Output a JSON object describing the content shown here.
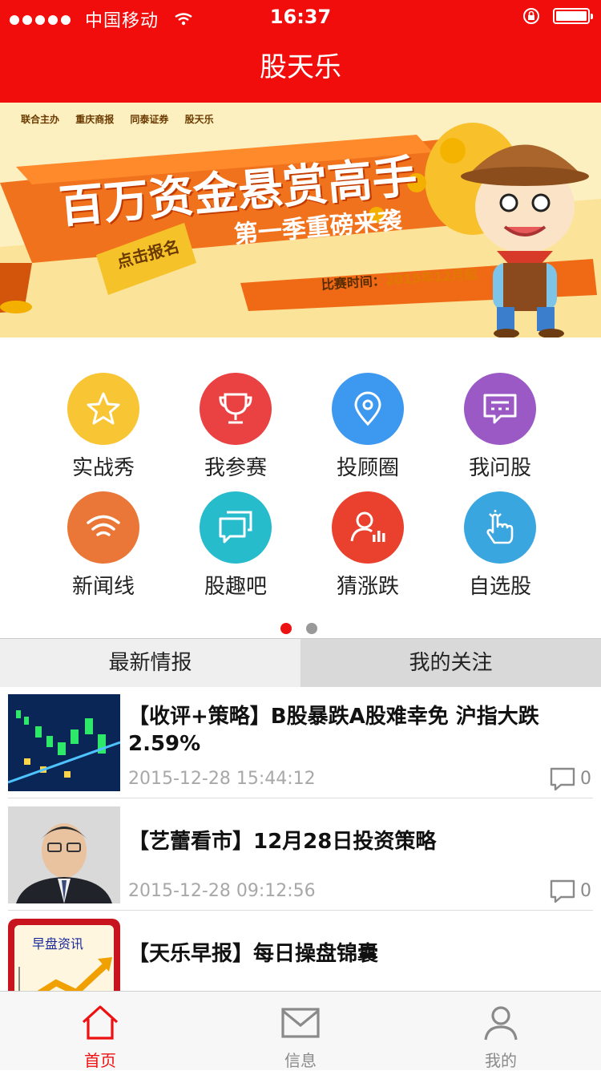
{
  "status_bar": {
    "carrier": "中国移动",
    "time": "16:37"
  },
  "header": {
    "title": "股天乐"
  },
  "banner": {
    "sponsors": [
      "联合主办",
      "重庆商报",
      "同泰证券",
      "股天乐"
    ],
    "main_title": "百万资金悬赏高手",
    "sub_title": "第一季重磅来袭",
    "cta": "点击报名",
    "date_label": "比赛时间：",
    "date_value": "2015年12月起"
  },
  "grid": {
    "items": [
      {
        "label": "实战秀",
        "icon": "star-icon",
        "color": "#f8c534"
      },
      {
        "label": "我参赛",
        "icon": "trophy-icon",
        "color": "#ea4242"
      },
      {
        "label": "投顾圈",
        "icon": "location-pin-icon",
        "color": "#3d98f0"
      },
      {
        "label": "我问股",
        "icon": "chat-icon",
        "color": "#9b59c6"
      },
      {
        "label": "新闻线",
        "icon": "wifi-icon",
        "color": "#ea7637"
      },
      {
        "label": "股趣吧",
        "icon": "chat-bubbles-icon",
        "color": "#27bccc"
      },
      {
        "label": "猜涨跌",
        "icon": "user-chart-icon",
        "color": "#e9412e"
      },
      {
        "label": "自选股",
        "icon": "hand-tap-icon",
        "color": "#3aa6e0"
      }
    ],
    "pager": {
      "active_color": "#ee1111",
      "inactive_color": "#999999"
    }
  },
  "tabs": {
    "items": [
      "最新情报",
      "我的关注"
    ]
  },
  "news": [
    {
      "title": "【收评+策略】B股暴跌A股难幸免 沪指大跌2.59%",
      "date": "2015-12-28 15:44:12",
      "comments": "0"
    },
    {
      "title": "【艺蕾看市】12月28日投资策略",
      "date": "2015-12-28 09:12:56",
      "comments": "0"
    },
    {
      "title": "【天乐早报】每日操盘锦囊",
      "thumb_text": "早盘资讯"
    }
  ],
  "tab_bar": {
    "items": [
      {
        "label": "首页",
        "icon": "home-icon",
        "active": true
      },
      {
        "label": "信息",
        "icon": "mail-icon",
        "active": false
      },
      {
        "label": "我的",
        "icon": "user-icon",
        "active": false
      }
    ],
    "active_color": "#ee1111",
    "inactive_color": "#8a8a8a"
  }
}
